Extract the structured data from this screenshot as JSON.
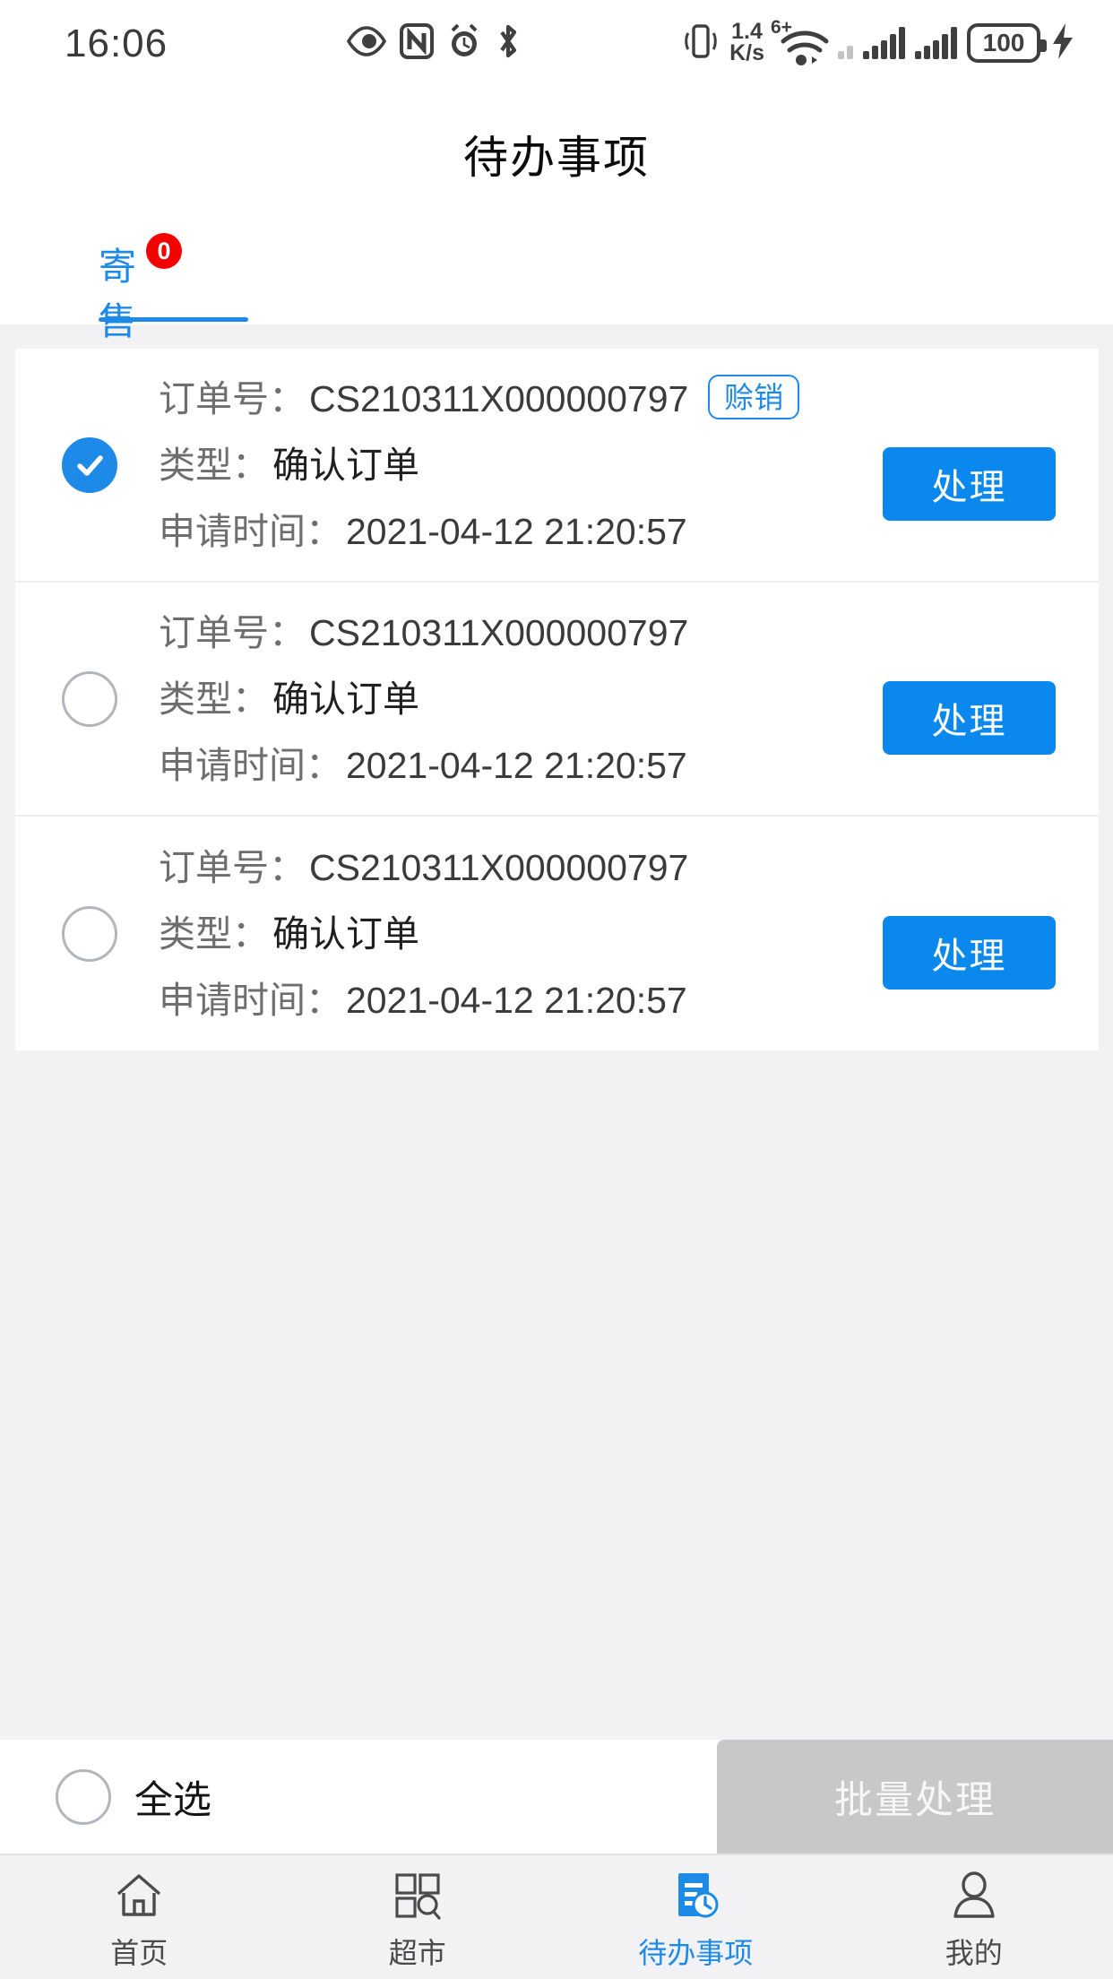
{
  "status_bar": {
    "time": "16:06",
    "left_icons": [
      "eye-icon",
      "nfc-icon",
      "alarm-icon",
      "bluetooth-icon"
    ],
    "net_speed_value": "1.4",
    "net_speed_unit": "K/s",
    "wifi_superscript": "6+",
    "battery_level": "100",
    "right_icons": [
      "vibrate-icon",
      "wifi-icon",
      "signal-bars-icon",
      "signal-bars-icon",
      "battery-icon",
      "charging-bolt-icon"
    ]
  },
  "header": {
    "title": "待办事项"
  },
  "tabs": [
    {
      "label": "寄售",
      "badge": "0",
      "active": true
    }
  ],
  "list": {
    "labels": {
      "order_no": "订单号：",
      "type": "类型：",
      "apply_time": "申请时间："
    },
    "rows": [
      {
        "checked": true,
        "order_no": "CS210311X000000797",
        "tag": "赊销",
        "type": "确认订单",
        "apply_time": "2021-04-12  21:20:57",
        "action_label": "处理"
      },
      {
        "checked": false,
        "order_no": "CS210311X000000797",
        "tag": "",
        "type": "确认订单",
        "apply_time": "2021-04-12  21:20:57",
        "action_label": "处理"
      },
      {
        "checked": false,
        "order_no": "CS210311X000000797",
        "tag": "",
        "type": "确认订单",
        "apply_time": "2021-04-12  21:20:57",
        "action_label": "处理"
      }
    ]
  },
  "action_bar": {
    "select_all_label": "全选",
    "select_all_checked": false,
    "batch_label": "批量处理",
    "batch_enabled": false
  },
  "tabbar": {
    "items": [
      {
        "label": "首页",
        "icon": "home-icon",
        "active": false
      },
      {
        "label": "超市",
        "icon": "grid-search-icon",
        "active": false
      },
      {
        "label": "待办事项",
        "icon": "todo-clock-icon",
        "active": true
      },
      {
        "label": "我的",
        "icon": "person-icon",
        "active": false
      }
    ]
  },
  "colors": {
    "accent": "#1e8ae8",
    "button": "#0b88ee",
    "badge_red": "#f40000",
    "disabled": "#c8c8c8",
    "page_bg": "#f2f2f4"
  }
}
